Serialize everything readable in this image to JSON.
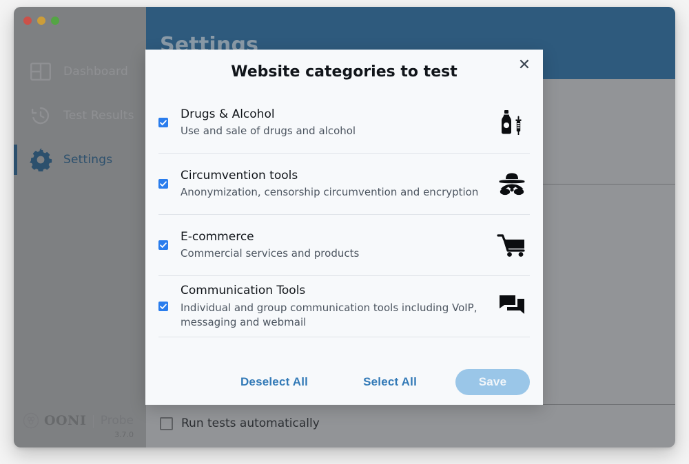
{
  "window": {
    "traffic_lights": [
      "close",
      "minimize",
      "zoom"
    ]
  },
  "sidebar": {
    "items": [
      {
        "label": "Dashboard",
        "icon": "dashboard-icon",
        "active": false
      },
      {
        "label": "Test Results",
        "icon": "history-clock-icon",
        "active": false
      },
      {
        "label": "Settings",
        "icon": "gear-icon",
        "active": true
      }
    ],
    "brand": {
      "name": "OONI",
      "separator": "|",
      "product": "Probe",
      "version": "3.7.0"
    }
  },
  "main": {
    "title": "Settings",
    "auto_run": {
      "label": "Run tests automatically",
      "checked": false
    }
  },
  "modal": {
    "title": "Website categories to test",
    "close_icon": "✕",
    "categories": [
      {
        "name": "Drugs & Alcohol",
        "description": "Use and sale of drugs and alcohol",
        "checked": true,
        "icon": "bottle-syringe-icon"
      },
      {
        "name": "Circumvention tools",
        "description": "Anonymization, censorship circumvention and encryption",
        "checked": true,
        "icon": "incognito-spy-icon"
      },
      {
        "name": "E-commerce",
        "description": "Commercial services and products",
        "checked": true,
        "icon": "shopping-cart-icon"
      },
      {
        "name": "Communication Tools",
        "description": "Individual and group communication tools including VoIP, messaging and webmail",
        "checked": true,
        "icon": "forum-chat-icon"
      }
    ],
    "footer": {
      "deselect_all": "Deselect All",
      "select_all": "Select All",
      "save": "Save"
    }
  },
  "colors": {
    "header_blue": "#2e5a7d",
    "accent_blue": "#2a7ded",
    "link_blue": "#337ab7",
    "save_blue": "#9ac6e8",
    "sidebar_grey": "#929497",
    "modal_bg": "#f7f9fb"
  }
}
